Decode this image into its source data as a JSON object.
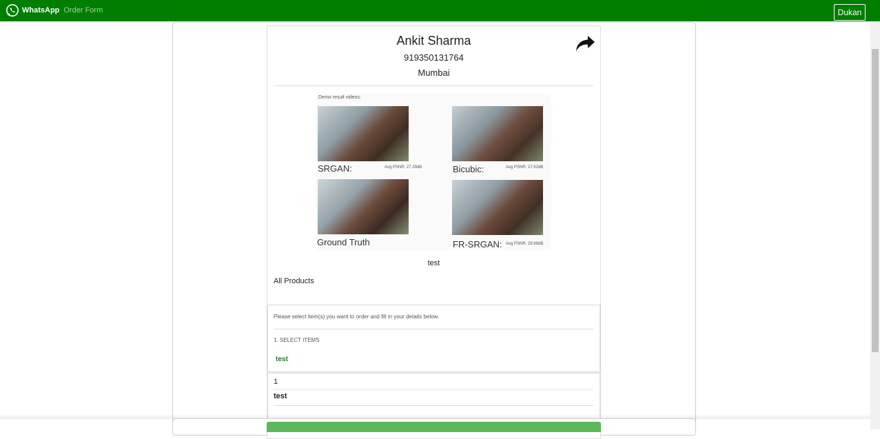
{
  "navbar": {
    "brand_name": "WhatsApp",
    "brand_sub": "Order Form",
    "dukan_button": "Dukan",
    "background_color": "#007e00"
  },
  "profile": {
    "name": "Ankit Sharma",
    "phone": "919350131764",
    "city": "Mumbai",
    "share_icon": "share-icon"
  },
  "banner": {
    "header": "Demo result videos:",
    "panels": [
      {
        "label": "SRGAN:",
        "metric": "Avg PSNR: 27.39dB"
      },
      {
        "label": "Bicubic:",
        "metric": "Avg PSNR: 27.52dB"
      },
      {
        "label": "Ground Truth",
        "metric": ""
      },
      {
        "label": "FR-SRGAN:",
        "metric": "Avg PSNR: 29.69dB"
      }
    ]
  },
  "store": {
    "caption": "test",
    "all_products": "All Products"
  },
  "order": {
    "instructions": "Please select item(s) you want to order and fill in your details below.",
    "step_heading": "1. SELECT ITEMS",
    "item_link": "test",
    "selected": {
      "quantity": "1",
      "name": "test"
    },
    "accent_color": "#5cb85c"
  }
}
